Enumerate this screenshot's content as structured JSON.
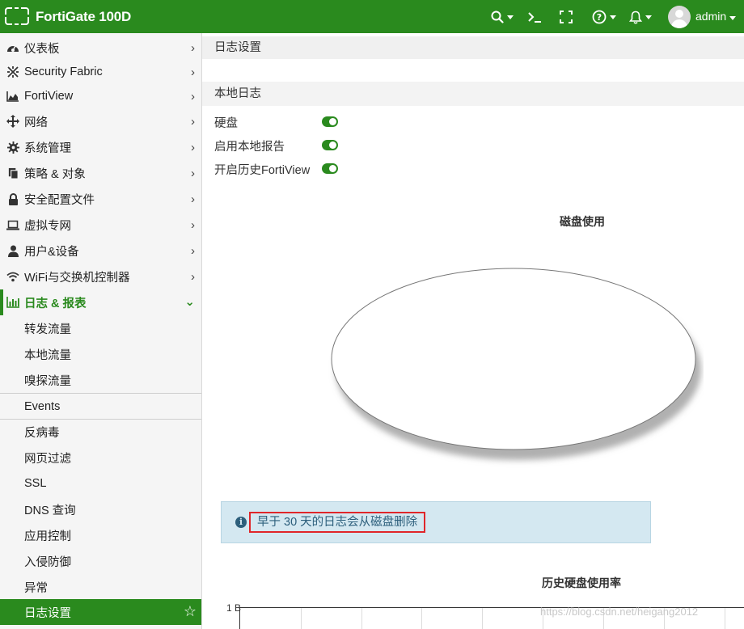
{
  "topbar": {
    "brand": "FortiGate 100D",
    "user": "admin",
    "icons": [
      "fortinet-logo-icon",
      "search-icon",
      "terminal-icon",
      "fullscreen-icon",
      "help-icon",
      "bell-icon",
      "user-avatar-icon"
    ]
  },
  "sidebar": {
    "items": [
      {
        "label": "仪表板",
        "icon": "dashboard-icon"
      },
      {
        "label": "Security Fabric",
        "icon": "fabric-icon"
      },
      {
        "label": "FortiView",
        "icon": "chart-area-icon"
      },
      {
        "label": "网络",
        "icon": "network-arrows-icon"
      },
      {
        "label": "系统管理",
        "icon": "gear-icon"
      },
      {
        "label": "策略 & 对象",
        "icon": "policy-icon"
      },
      {
        "label": "安全配置文件",
        "icon": "lock-icon"
      },
      {
        "label": "虚拟专网",
        "icon": "laptop-icon"
      },
      {
        "label": "用户&设备",
        "icon": "user-icon"
      },
      {
        "label": "WiFi与交换机控制器",
        "icon": "wifi-icon"
      },
      {
        "label": "日志 & 报表",
        "icon": "bar-chart-icon"
      }
    ],
    "sub_items": [
      {
        "label": "转发流量"
      },
      {
        "label": "本地流量"
      },
      {
        "label": "嗅探流量"
      },
      {
        "label": "Events"
      },
      {
        "label": "反病毒"
      },
      {
        "label": "网页过滤"
      },
      {
        "label": "SSL"
      },
      {
        "label": "DNS 查询"
      },
      {
        "label": "应用控制"
      },
      {
        "label": "入侵防御"
      },
      {
        "label": "异常"
      },
      {
        "label": "日志设置"
      }
    ]
  },
  "main": {
    "page_title": "日志设置",
    "section_title": "本地日志",
    "toggles": [
      {
        "label": "硬盘",
        "on": true
      },
      {
        "label": "启用本地报告",
        "on": true
      },
      {
        "label": "开启历史FortiView",
        "on": true
      }
    ],
    "disk_chart_title": "磁盘使用",
    "info_message": "早于 30 天的日志会从磁盘删除",
    "history_chart_title": "历史硬盘使用率",
    "history_y_tick": "1 B",
    "watermark": "https://blog.csdn.net/heigang2012"
  },
  "colors": {
    "brand_green": "#2a8a1e",
    "info_bg": "#d4e8f1",
    "info_text": "#2d5f7c",
    "highlight_red": "#e0262a"
  }
}
